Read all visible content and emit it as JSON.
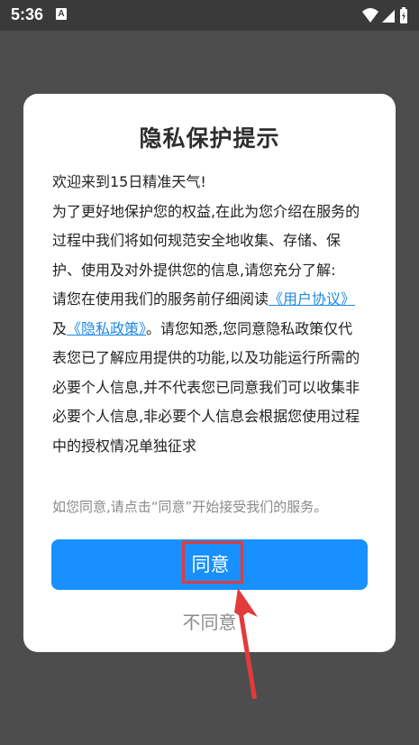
{
  "status_bar": {
    "time": "5:36",
    "notification_letter": "A",
    "icons": [
      "wifi-icon",
      "signal-icon",
      "battery-icon"
    ]
  },
  "dialog": {
    "title": "隐私保护提示",
    "welcome": "欢迎来到15日精准天气!",
    "intro": "为了更好地保护您的权益,在此为您介绍在服务的过程中我们将如何规范安全地收集、存储、保护、使用及对外提供您的信息,请您充分了解:",
    "read_prefix": "请您在使用我们的服务前仔细阅读",
    "user_agreement_link": "《用户协议》",
    "conjunction": "及",
    "privacy_policy_link": "《隐私政策》",
    "read_suffix": "。请您知悉,您同意隐私政策仅代表您已了解应用提供的功能,以及功能运行所需的必要个人信息,并不代表您已同意我们可以收集非必要个人信息,非必要个人信息会根据您使用过程中的授权情况单独征求",
    "consent_hint": "如您同意,请点击“同意”开始接受我们的服务。",
    "agree_label": "同意",
    "disagree_label": "不同意"
  },
  "colors": {
    "accent": "#1890ff",
    "link": "#1e88e5",
    "annotation": "#e23b3b",
    "backdrop": "#4d4d4d"
  }
}
